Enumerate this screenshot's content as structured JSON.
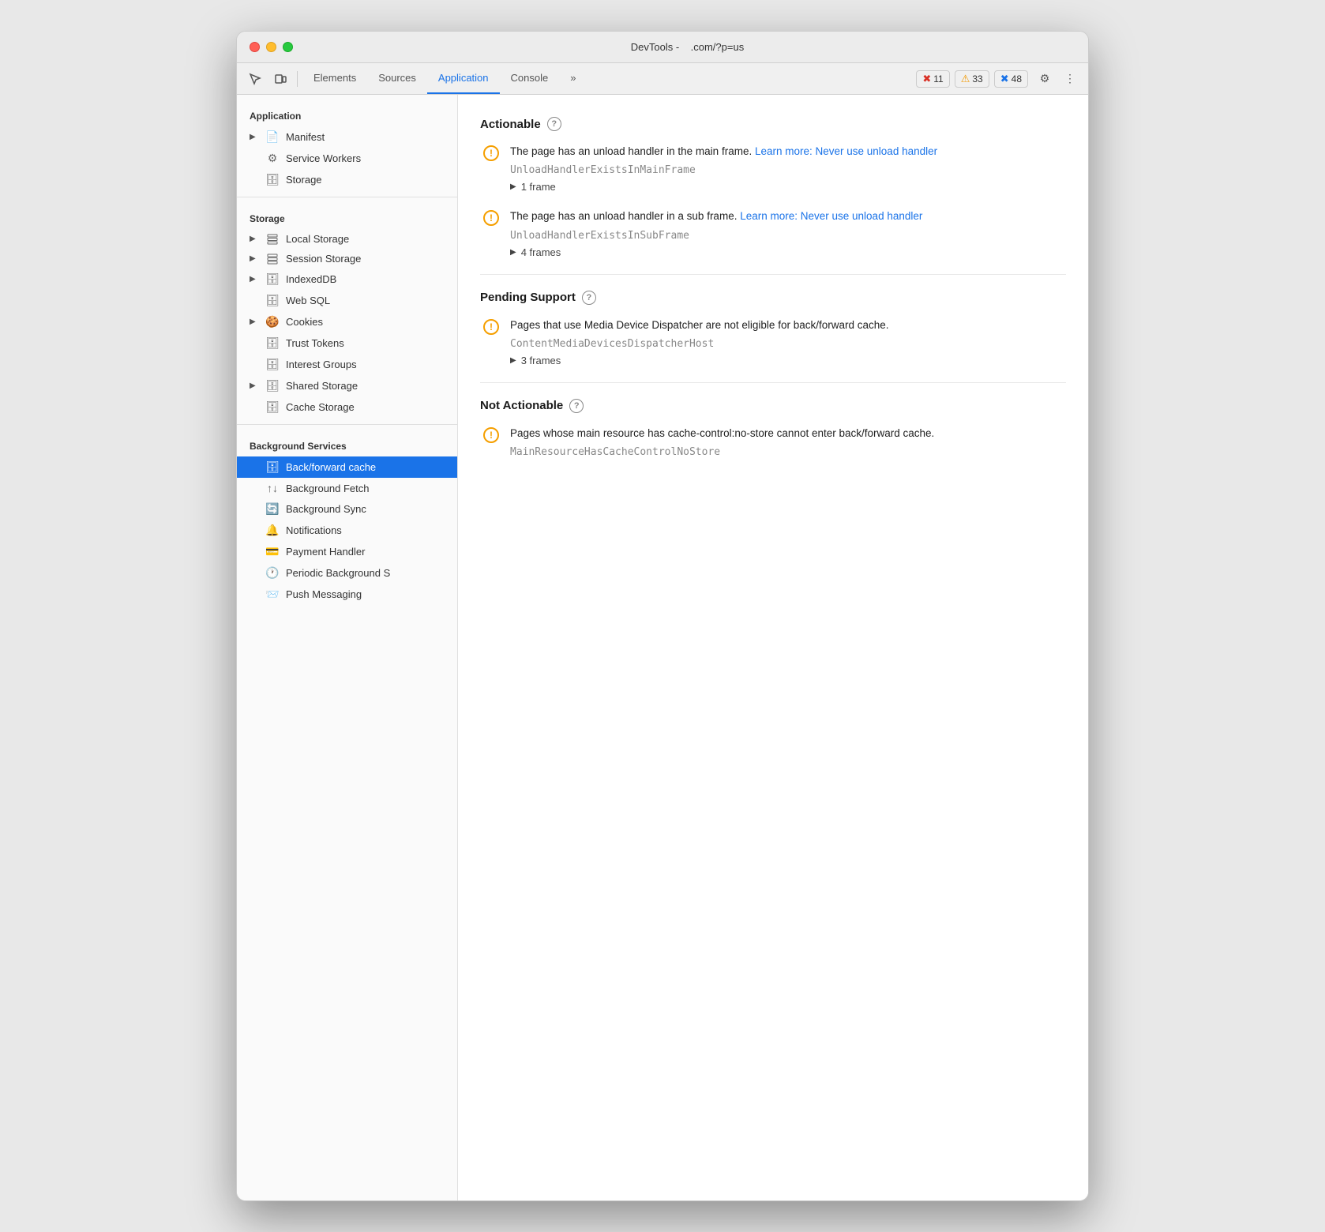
{
  "window": {
    "title": "DevTools -",
    "url": ".com/?p=us"
  },
  "toolbar": {
    "tabs": [
      {
        "id": "elements",
        "label": "Elements",
        "active": false
      },
      {
        "id": "sources",
        "label": "Sources",
        "active": false
      },
      {
        "id": "application",
        "label": "Application",
        "active": true
      },
      {
        "id": "console",
        "label": "Console",
        "active": false
      }
    ],
    "badges": [
      {
        "type": "error",
        "count": "11"
      },
      {
        "type": "warning",
        "count": "33"
      },
      {
        "type": "info",
        "count": "48"
      }
    ]
  },
  "sidebar": {
    "sections": [
      {
        "id": "application",
        "title": "Application",
        "items": [
          {
            "id": "manifest",
            "label": "Manifest",
            "icon": "file",
            "indent": false,
            "toggle": true
          },
          {
            "id": "service-workers",
            "label": "Service Workers",
            "icon": "gear",
            "indent": false,
            "toggle": false
          },
          {
            "id": "storage",
            "label": "Storage",
            "icon": "db",
            "indent": false,
            "toggle": false
          }
        ]
      },
      {
        "id": "storage-section",
        "title": "Storage",
        "items": [
          {
            "id": "local-storage",
            "label": "Local Storage",
            "icon": "grid",
            "indent": false,
            "toggle": true
          },
          {
            "id": "session-storage",
            "label": "Session Storage",
            "icon": "grid",
            "indent": false,
            "toggle": true
          },
          {
            "id": "indexeddb",
            "label": "IndexedDB",
            "icon": "db",
            "indent": false,
            "toggle": true
          },
          {
            "id": "web-sql",
            "label": "Web SQL",
            "icon": "db",
            "indent": false,
            "toggle": false
          },
          {
            "id": "cookies",
            "label": "Cookies",
            "icon": "cookie",
            "indent": false,
            "toggle": true
          },
          {
            "id": "trust-tokens",
            "label": "Trust Tokens",
            "icon": "db",
            "indent": false,
            "toggle": false
          },
          {
            "id": "interest-groups",
            "label": "Interest Groups",
            "icon": "db",
            "indent": false,
            "toggle": false
          },
          {
            "id": "shared-storage",
            "label": "Shared Storage",
            "icon": "db",
            "indent": false,
            "toggle": true
          },
          {
            "id": "cache-storage",
            "label": "Cache Storage",
            "icon": "db",
            "indent": false,
            "toggle": false
          }
        ]
      },
      {
        "id": "background-services",
        "title": "Background Services",
        "items": [
          {
            "id": "back-forward-cache",
            "label": "Back/forward cache",
            "icon": "db",
            "indent": false,
            "toggle": false,
            "active": true
          },
          {
            "id": "background-fetch",
            "label": "Background Fetch",
            "icon": "arrows",
            "indent": false,
            "toggle": false
          },
          {
            "id": "background-sync",
            "label": "Background Sync",
            "icon": "sync",
            "indent": false,
            "toggle": false
          },
          {
            "id": "notifications",
            "label": "Notifications",
            "icon": "bell",
            "indent": false,
            "toggle": false
          },
          {
            "id": "payment-handler",
            "label": "Payment Handler",
            "icon": "card",
            "indent": false,
            "toggle": false
          },
          {
            "id": "periodic-background",
            "label": "Periodic Background S",
            "icon": "clock",
            "indent": false,
            "toggle": false
          },
          {
            "id": "push-messaging",
            "label": "Push Messaging",
            "icon": "push",
            "indent": false,
            "toggle": false
          }
        ]
      }
    ]
  },
  "content": {
    "sections": [
      {
        "id": "actionable",
        "title": "Actionable",
        "issues": [
          {
            "id": "unload-main",
            "message": "The page has an unload handler in the main frame.",
            "link_text": "Learn more: Never use unload handler",
            "code": "UnloadHandlerExistsInMainFrame",
            "expand_label": "1 frame"
          },
          {
            "id": "unload-sub",
            "message": "The page has an unload handler in a sub frame.",
            "link_text": "Learn more: Never use unload handler",
            "code": "UnloadHandlerExistsInSubFrame",
            "expand_label": "4 frames"
          }
        ]
      },
      {
        "id": "pending-support",
        "title": "Pending Support",
        "issues": [
          {
            "id": "media-device-dispatcher",
            "message": "Pages that use Media Device Dispatcher are not eligible for back/forward cache.",
            "link_text": "",
            "code": "ContentMediaDevicesDispatcherHost",
            "expand_label": "3 frames"
          }
        ]
      },
      {
        "id": "not-actionable",
        "title": "Not Actionable",
        "issues": [
          {
            "id": "cache-control-no-store",
            "message": "Pages whose main resource has cache-control:no-store cannot enter back/forward cache.",
            "link_text": "",
            "code": "MainResourceHasCacheControlNoStore",
            "expand_label": ""
          }
        ]
      }
    ]
  }
}
